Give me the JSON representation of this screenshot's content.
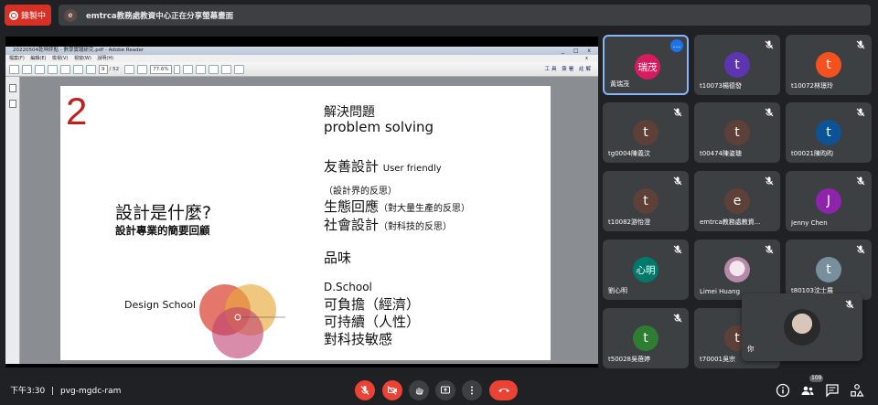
{
  "topbar": {
    "record_label": "錄製中",
    "presenter_initial": "e",
    "presenting_text": "emtrca教務處教資中心正在分享螢幕畫面"
  },
  "reader": {
    "window_title": "20220504乾坤評點 - 數學實踐研究.pdf - Adobe Reader",
    "window_controls": "_ □ x",
    "menu": [
      "檔案(F)",
      "編輯(E)",
      "檢視(V)",
      "視窗(W)",
      "說明(H)"
    ],
    "menu_close": "x",
    "page_current": "9",
    "page_total": "/ 52",
    "zoom": "77.6%",
    "right_tools": [
      "工具",
      "簽署",
      "註解"
    ]
  },
  "slide": {
    "number": "2",
    "title": "設計是什麼?",
    "subtitle": "設計專業的簡要回顧",
    "design_school": "Design School",
    "venn_colors": [
      "#d94a3a",
      "#e8a93a",
      "#c04070"
    ],
    "lines": [
      {
        "text": "解決問題",
        "small": ""
      },
      {
        "text": " problem solving",
        "small": ""
      },
      {
        "text": "友善設計 ",
        "small": "User friendly"
      },
      {
        "text": "",
        "small": "（設計界的反思）"
      },
      {
        "text": "生態回應",
        "small": "（對大量生產的反思）"
      },
      {
        "text": "社會設計",
        "small": "（對科技的反思）"
      },
      {
        "text": "品味",
        "small": ""
      },
      {
        "text": "D.School",
        "small": ""
      },
      {
        "text": "可負擔（經濟）",
        "small": ""
      },
      {
        "text": "可持續（人性）",
        "small": ""
      },
      {
        "text": "對科技敏感",
        "small": ""
      }
    ]
  },
  "participants": [
    {
      "initial": "瑞茂",
      "name": "黃瑞茂",
      "color": "#d81b60",
      "active": true
    },
    {
      "initial": "t",
      "name": "t10073楊德發",
      "color": "#5e35b1"
    },
    {
      "initial": "t",
      "name": "t10072林璟玲",
      "color": "#f4511e"
    },
    {
      "initial": "t",
      "name": "tg0004陳義汶",
      "color": "#5d4037"
    },
    {
      "initial": "t",
      "name": "t00474陳姿瑭",
      "color": "#5d4037"
    },
    {
      "initial": "t",
      "name": "t00021陳昀昀",
      "color": "#0b5394"
    },
    {
      "initial": "t",
      "name": "t10082游怡澄",
      "color": "#5d4037"
    },
    {
      "initial": "e",
      "name": "emtrca教務處教資...",
      "color": "#5d4037"
    },
    {
      "initial": "J",
      "name": "Jenny Chen",
      "color": "#8e24aa"
    },
    {
      "initial": "心明",
      "name": "劉心明",
      "color": "#00796b"
    },
    {
      "initial": "",
      "name": "Limei Huang",
      "color": "#e8d0e8",
      "photo": true
    },
    {
      "initial": "t",
      "name": "t80103沈士展",
      "color": "#78909c"
    },
    {
      "initial": "t",
      "name": "t50028吳蓓婷",
      "color": "#2e7d32"
    },
    {
      "initial": "t",
      "name": "t70001吳宗",
      "color": "#5d4037"
    }
  ],
  "self_view": {
    "name": "你"
  },
  "bottombar": {
    "time": "下午3:30",
    "separator": "|",
    "meeting_code": "pvg-mgdc-ram",
    "participant_count": "109"
  },
  "colors": {
    "background": "#202124",
    "tile": "#3c4043",
    "danger": "#ea4335",
    "accent": "#1a73e8"
  }
}
